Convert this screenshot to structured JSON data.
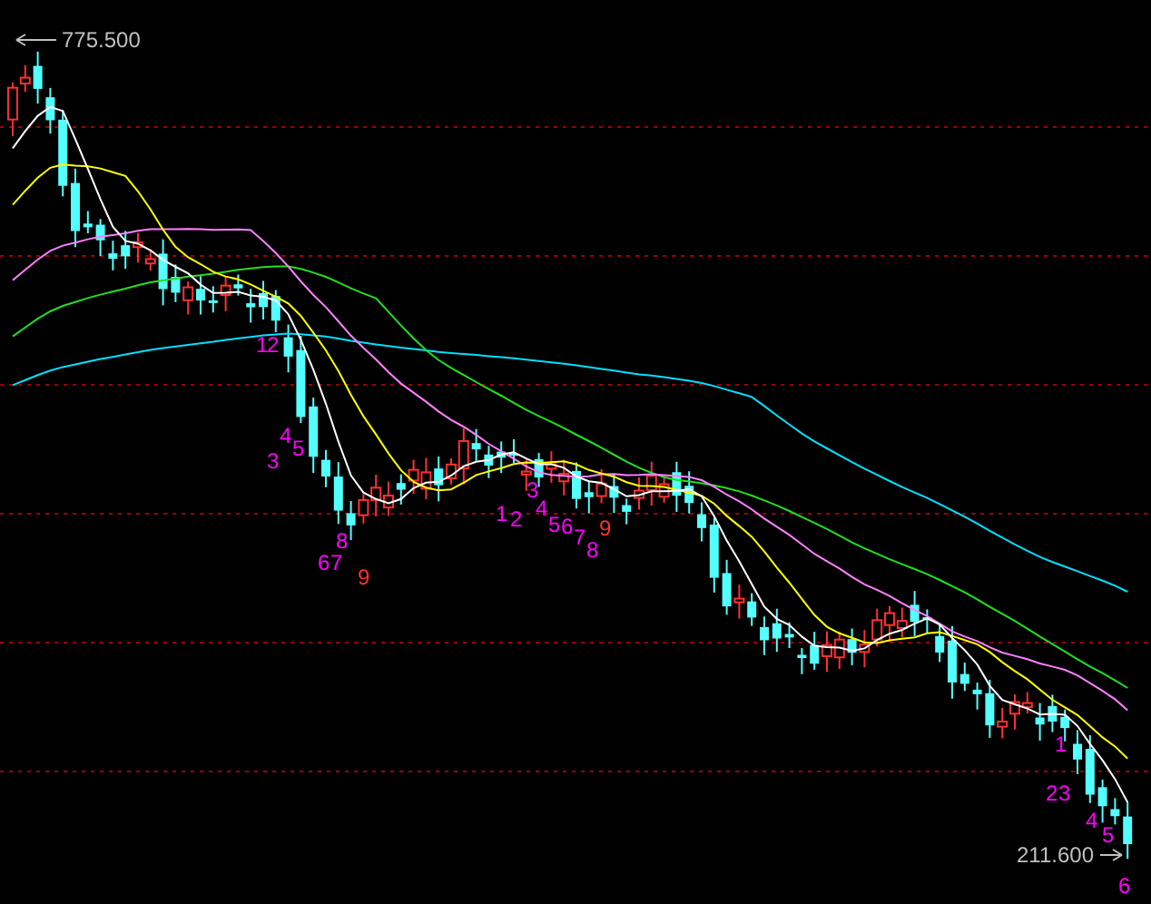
{
  "price_labels": {
    "high": "775.500",
    "low": "211.600"
  },
  "markers": [
    {
      "text": "1",
      "color": "#ff00ff"
    },
    {
      "text": "2",
      "color": "#ff00ff"
    },
    {
      "text": "3",
      "color": "#ff00ff"
    },
    {
      "text": "4",
      "color": "#ff00ff"
    },
    {
      "text": "5",
      "color": "#ff00ff"
    },
    {
      "text": "6",
      "color": "#ff00ff"
    },
    {
      "text": "7",
      "color": "#ff00ff"
    },
    {
      "text": "8",
      "color": "#ff00ff"
    },
    {
      "text": "9",
      "color": "#ff3030"
    },
    {
      "text": "1",
      "color": "#ff00ff"
    },
    {
      "text": "2",
      "color": "#ff00ff"
    },
    {
      "text": "3",
      "color": "#ff00ff"
    },
    {
      "text": "4",
      "color": "#ff00ff"
    },
    {
      "text": "5",
      "color": "#ff00ff"
    },
    {
      "text": "6",
      "color": "#ff00ff"
    },
    {
      "text": "7",
      "color": "#ff00ff"
    },
    {
      "text": "8",
      "color": "#ff00ff"
    },
    {
      "text": "9",
      "color": "#ff3030"
    },
    {
      "text": "1",
      "color": "#ff00ff"
    },
    {
      "text": "2",
      "color": "#ff00ff"
    },
    {
      "text": "3",
      "color": "#ff00ff"
    },
    {
      "text": "4",
      "color": "#ff00ff"
    },
    {
      "text": "5",
      "color": "#ff00ff"
    },
    {
      "text": "6",
      "color": "#ff00ff"
    }
  ]
}
